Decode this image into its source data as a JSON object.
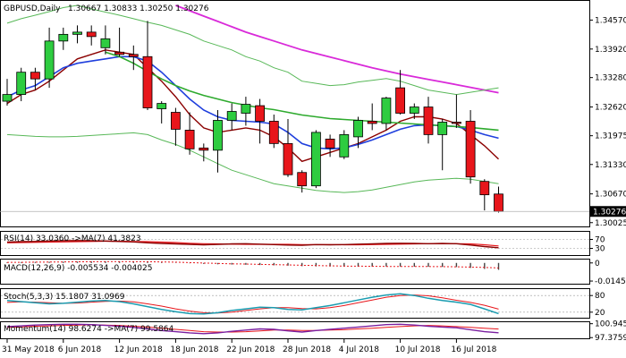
{
  "window": {
    "symbol_title": "GBPUSD,Daily",
    "ohlc_readout": "1.30667 1.30833 1.30250 1.30276"
  },
  "colors": {
    "bull": "#2ecc40",
    "bear": "#e8161b",
    "ma_blue": "#1f3fdd",
    "ma_darkred": "#8b0000",
    "ma_green": "#2eaa2e",
    "ma_magenta": "#d92ad9",
    "bollinger": "#58b858",
    "price_label_bg": "#000000",
    "price_label_text": "#ffffff"
  },
  "chart_data": {
    "type": "candlestick",
    "symbol": "GBPUSD",
    "timeframe": "Daily",
    "ylim": [
      1.3,
      1.349
    ],
    "y_ticks": [
      "1.34570",
      "1.33920",
      "1.33280",
      "1.32620",
      "1.31975",
      "1.31330",
      "1.30670",
      "1.30025"
    ],
    "y_tick_values": [
      1.3457,
      1.3392,
      1.3328,
      1.3262,
      1.31975,
      1.3133,
      1.3067,
      1.30025
    ],
    "last_price": "1.30276",
    "last_price_value": 1.30276,
    "x_ticks": [
      {
        "label": "31 May 2018",
        "index": 0
      },
      {
        "label": "6 Jun 2018",
        "index": 4
      },
      {
        "label": "12 Jun 2018",
        "index": 8
      },
      {
        "label": "18 Jun 2018",
        "index": 12
      },
      {
        "label": "22 Jun 2018",
        "index": 16
      },
      {
        "label": "28 Jun 2018",
        "index": 20
      },
      {
        "label": "4 Jul 2018",
        "index": 24
      },
      {
        "label": "10 Jul 2018",
        "index": 28
      },
      {
        "label": "16 Jul 2018",
        "index": 32
      }
    ],
    "candles": [
      {
        "o": 1.3275,
        "h": 1.3325,
        "l": 1.3265,
        "c": 1.329
      },
      {
        "o": 1.329,
        "h": 1.335,
        "l": 1.3275,
        "c": 1.334
      },
      {
        "o": 1.334,
        "h": 1.335,
        "l": 1.33,
        "c": 1.3325
      },
      {
        "o": 1.3325,
        "h": 1.344,
        "l": 1.3305,
        "c": 1.341
      },
      {
        "o": 1.341,
        "h": 1.344,
        "l": 1.339,
        "c": 1.3425
      },
      {
        "o": 1.3425,
        "h": 1.3445,
        "l": 1.3405,
        "c": 1.343
      },
      {
        "o": 1.343,
        "h": 1.3445,
        "l": 1.34,
        "c": 1.342
      },
      {
        "o": 1.3395,
        "h": 1.3445,
        "l": 1.338,
        "c": 1.3415
      },
      {
        "o": 1.3385,
        "h": 1.344,
        "l": 1.3375,
        "c": 1.338
      },
      {
        "o": 1.338,
        "h": 1.34,
        "l": 1.3345,
        "c": 1.3375
      },
      {
        "o": 1.3375,
        "h": 1.3455,
        "l": 1.3255,
        "c": 1.326
      },
      {
        "o": 1.3258,
        "h": 1.3275,
        "l": 1.3225,
        "c": 1.327
      },
      {
        "o": 1.325,
        "h": 1.326,
        "l": 1.3175,
        "c": 1.3212
      },
      {
        "o": 1.321,
        "h": 1.325,
        "l": 1.3155,
        "c": 1.3168
      },
      {
        "o": 1.317,
        "h": 1.318,
        "l": 1.314,
        "c": 1.3165
      },
      {
        "o": 1.3165,
        "h": 1.3255,
        "l": 1.3115,
        "c": 1.3232
      },
      {
        "o": 1.3232,
        "h": 1.327,
        "l": 1.321,
        "c": 1.3252
      },
      {
        "o": 1.3248,
        "h": 1.3285,
        "l": 1.322,
        "c": 1.3268
      },
      {
        "o": 1.3265,
        "h": 1.328,
        "l": 1.318,
        "c": 1.323
      },
      {
        "o": 1.323,
        "h": 1.3245,
        "l": 1.317,
        "c": 1.318
      },
      {
        "o": 1.318,
        "h": 1.3235,
        "l": 1.3105,
        "c": 1.311
      },
      {
        "o": 1.3115,
        "h": 1.312,
        "l": 1.307,
        "c": 1.3085
      },
      {
        "o": 1.3085,
        "h": 1.321,
        "l": 1.308,
        "c": 1.3205
      },
      {
        "o": 1.319,
        "h": 1.32,
        "l": 1.315,
        "c": 1.317
      },
      {
        "o": 1.315,
        "h": 1.321,
        "l": 1.3145,
        "c": 1.32
      },
      {
        "o": 1.3195,
        "h": 1.324,
        "l": 1.317,
        "c": 1.3232
      },
      {
        "o": 1.323,
        "h": 1.327,
        "l": 1.321,
        "c": 1.3225
      },
      {
        "o": 1.3225,
        "h": 1.3285,
        "l": 1.321,
        "c": 1.3282
      },
      {
        "o": 1.3305,
        "h": 1.3345,
        "l": 1.3245,
        "c": 1.3248
      },
      {
        "o": 1.3248,
        "h": 1.327,
        "l": 1.3235,
        "c": 1.3262
      },
      {
        "o": 1.3262,
        "h": 1.3285,
        "l": 1.318,
        "c": 1.32
      },
      {
        "o": 1.32,
        "h": 1.3235,
        "l": 1.312,
        "c": 1.3228
      },
      {
        "o": 1.3228,
        "h": 1.329,
        "l": 1.3215,
        "c": 1.3225
      },
      {
        "o": 1.323,
        "h": 1.3255,
        "l": 1.309,
        "c": 1.3105
      },
      {
        "o": 1.3095,
        "h": 1.31,
        "l": 1.303,
        "c": 1.3065
      },
      {
        "o": 1.30667,
        "h": 1.30833,
        "l": 1.3025,
        "c": 1.30276
      }
    ],
    "series": [
      {
        "values": [
          1.327,
          1.329,
          1.33,
          1.332,
          1.3345,
          1.337,
          1.338,
          1.339,
          1.3385,
          1.338,
          1.335,
          1.332,
          1.3285,
          1.3245,
          1.3215,
          1.3205,
          1.321,
          1.3215,
          1.321,
          1.3195,
          1.317,
          1.314,
          1.315,
          1.316,
          1.317,
          1.318,
          1.3195,
          1.321,
          1.323,
          1.324,
          1.324,
          1.3235,
          1.3225,
          1.32,
          1.3175,
          1.3145
        ]
      },
      {
        "values": [
          1.3285,
          1.33,
          1.331,
          1.333,
          1.335,
          1.336,
          1.3365,
          1.337,
          1.3375,
          1.3375,
          1.3365,
          1.334,
          1.331,
          1.328,
          1.3255,
          1.324,
          1.3232,
          1.323,
          1.3228,
          1.3224,
          1.3205,
          1.318,
          1.317,
          1.3168,
          1.317,
          1.3178,
          1.3188,
          1.32,
          1.3212,
          1.322,
          1.3222,
          1.322,
          1.3218,
          1.321,
          1.32,
          1.3192
        ]
      },
      {
        "values": [
          null,
          null,
          null,
          null,
          null,
          null,
          null,
          1.3385,
          1.3375,
          1.336,
          1.3342,
          1.3325,
          1.331,
          1.3298,
          1.3288,
          1.328,
          1.3272,
          1.3266,
          1.326,
          1.3256,
          1.325,
          1.3244,
          1.324,
          1.3236,
          1.3234,
          1.3232,
          1.323,
          1.3228,
          1.3226,
          1.3224,
          1.3222,
          1.322,
          1.3218,
          1.3216,
          1.3213,
          1.321
        ]
      },
      {
        "values": [
          null,
          null,
          null,
          null,
          null,
          null,
          null,
          null,
          null,
          null,
          null,
          null,
          1.349,
          1.3478,
          1.3466,
          1.3454,
          1.3442,
          1.343,
          1.342,
          1.341,
          1.34,
          1.339,
          1.3382,
          1.3374,
          1.3366,
          1.3358,
          1.335,
          1.3343,
          1.3336,
          1.333,
          1.3324,
          1.3318,
          1.3312,
          1.3306,
          1.33,
          1.3294
        ]
      },
      {
        "values": [
          1.345,
          1.346,
          1.3468,
          1.3476,
          1.3485,
          1.349,
          1.3482,
          1.3475,
          1.3468,
          1.346,
          1.3452,
          1.3445,
          1.3435,
          1.3425,
          1.341,
          1.34,
          1.339,
          1.3375,
          1.3365,
          1.335,
          1.334,
          1.332,
          1.3315,
          1.331,
          1.3312,
          1.3318,
          1.3322,
          1.3326,
          1.332,
          1.331,
          1.33,
          1.3295,
          1.329,
          1.3295,
          1.33,
          1.3305
        ]
      },
      {
        "values": [
          1.32,
          1.3198,
          1.3196,
          1.3195,
          1.3195,
          1.3196,
          1.3198,
          1.32,
          1.3202,
          1.3204,
          1.32,
          1.3188,
          1.3178,
          1.3165,
          1.315,
          1.3135,
          1.312,
          1.311,
          1.31,
          1.309,
          1.3085,
          1.308,
          1.3075,
          1.3072,
          1.307,
          1.3072,
          1.3076,
          1.3082,
          1.3088,
          1.3094,
          1.3098,
          1.31,
          1.3102,
          1.31,
          1.3095,
          1.309
        ]
      }
    ],
    "last_value_stub": 1.30276
  },
  "rsi": {
    "label": "RSI(14) 33.0360  ->MA(7) 41.3823",
    "ticks": [
      "70",
      "30"
    ],
    "ylim": [
      0,
      100
    ],
    "values": [
      58,
      60,
      61,
      63,
      64,
      65,
      64,
      63,
      61,
      59,
      55,
      52,
      50,
      48,
      46,
      48,
      50,
      51,
      49,
      47,
      45,
      44,
      47,
      46,
      47,
      49,
      50,
      52,
      53,
      52,
      51,
      52,
      51,
      45,
      38,
      33
    ],
    "ma_values": [
      55,
      56,
      57,
      58,
      59,
      60,
      61,
      62,
      62,
      61,
      60,
      58,
      56,
      53,
      51,
      50,
      49,
      48,
      48,
      48,
      48,
      47,
      47,
      47,
      46,
      46,
      47,
      48,
      49,
      50,
      51,
      51,
      51,
      50,
      46,
      41
    ]
  },
  "macd": {
    "label": "MACD(12,26,9) -0.005534 -0.004025",
    "ticks": [
      "0",
      "-0.014585"
    ],
    "ylim": [
      -0.016,
      0.002
    ],
    "histogram": [
      0.0006,
      0.0007,
      0.0008,
      0.0009,
      0.001,
      0.0011,
      0.0012,
      0.0013,
      0.0013,
      0.0012,
      0.001,
      0.0006,
      0.0002,
      -0.0003,
      -0.0008,
      -0.0011,
      -0.0013,
      -0.0015,
      -0.0017,
      -0.0019,
      -0.0022,
      -0.0026,
      -0.0028,
      -0.0029,
      -0.003,
      -0.003,
      -0.003,
      -0.0029,
      -0.0029,
      -0.003,
      -0.0031,
      -0.0032,
      -0.0033,
      -0.004,
      -0.0048,
      -0.005534
    ],
    "signal": [
      0.0004,
      0.0005,
      0.0006,
      0.0007,
      0.0008,
      0.0009,
      0.001,
      0.0011,
      0.0011,
      0.0011,
      0.001,
      0.0008,
      0.0006,
      0.0003,
      -0.0001,
      -0.0004,
      -0.0007,
      -0.0009,
      -0.0012,
      -0.0014,
      -0.0016,
      -0.0019,
      -0.0021,
      -0.0023,
      -0.0025,
      -0.0026,
      -0.0027,
      -0.0028,
      -0.0028,
      -0.0029,
      -0.0029,
      -0.003,
      -0.0031,
      -0.0033,
      -0.0036,
      -0.004025
    ]
  },
  "stoch": {
    "label": "Stoch(5,3,3) 15.1807 31.0969",
    "ticks": [
      "80",
      "20"
    ],
    "ylim": [
      0,
      100
    ],
    "k": [
      62,
      58,
      54,
      50,
      52,
      56,
      60,
      62,
      58,
      50,
      40,
      30,
      22,
      15,
      14,
      18,
      26,
      32,
      38,
      36,
      30,
      28,
      36,
      44,
      54,
      64,
      74,
      82,
      86,
      80,
      70,
      62,
      56,
      48,
      32,
      15
    ],
    "d": [
      55,
      57,
      56,
      54,
      52,
      53,
      56,
      59,
      60,
      57,
      50,
      42,
      32,
      24,
      18,
      17,
      20,
      26,
      32,
      36,
      36,
      33,
      32,
      36,
      44,
      54,
      64,
      74,
      80,
      82,
      79,
      72,
      63,
      55,
      45,
      31
    ]
  },
  "momentum": {
    "label": "Momentum(14) 98.6274 ->MA(7) 99.5864",
    "ticks": [
      "100.945",
      "97.37594"
    ],
    "ylim": [
      97.2,
      101.1
    ],
    "values": [
      100.2,
      100.4,
      100.6,
      100.7,
      100.8,
      100.8,
      100.7,
      100.5,
      100.3,
      100.0,
      99.6,
      99.2,
      98.9,
      98.6,
      98.4,
      98.6,
      99.0,
      99.3,
      99.6,
      99.5,
      99.1,
      98.8,
      99.2,
      99.5,
      99.8,
      100.1,
      100.4,
      100.7,
      100.8,
      100.6,
      100.3,
      100.1,
      99.9,
      99.4,
      98.9,
      98.6274
    ],
    "ma_values": [
      100.0,
      100.1,
      100.3,
      100.4,
      100.5,
      100.6,
      100.7,
      100.6,
      100.5,
      100.3,
      100.1,
      99.8,
      99.5,
      99.2,
      98.9,
      98.8,
      98.8,
      98.9,
      99.1,
      99.3,
      99.3,
      99.2,
      99.2,
      99.3,
      99.4,
      99.6,
      99.8,
      100.0,
      100.2,
      100.4,
      100.5,
      100.4,
      100.2,
      100.0,
      99.8,
      99.5864
    ]
  }
}
